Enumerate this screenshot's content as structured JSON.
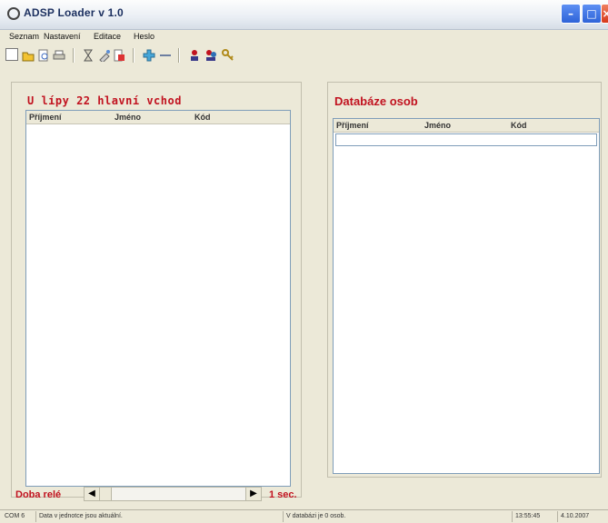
{
  "window": {
    "title": "ADSP Loader v 1.0"
  },
  "menu": [
    "Seznam",
    "Nastavení",
    "Editace",
    "Heslo"
  ],
  "toolbar": {
    "icons": [
      "new-icon",
      "open-icon",
      "print-preview-icon",
      "print-icon",
      "hourglass-icon",
      "settings-icon",
      "export-icon",
      "add-icon",
      "remove-icon",
      "user-icon",
      "users-icon",
      "key-icon"
    ]
  },
  "left_panel": {
    "title": "U lípy 22 hlavní vchod",
    "columns": [
      "Příjmení",
      "Jméno",
      "Kód"
    ]
  },
  "right_panel": {
    "title": "Databáze osob",
    "columns": [
      "Příjmení",
      "Jméno",
      "Kód"
    ]
  },
  "relay": {
    "label": "Doba relé",
    "value": "1 sec."
  },
  "status": {
    "port": "COM 6",
    "message": "Data v jednotce jsou aktuální.",
    "db_message": "V databázi je 0 osob.",
    "time": "13:55:45",
    "date": "4.10.2007"
  }
}
